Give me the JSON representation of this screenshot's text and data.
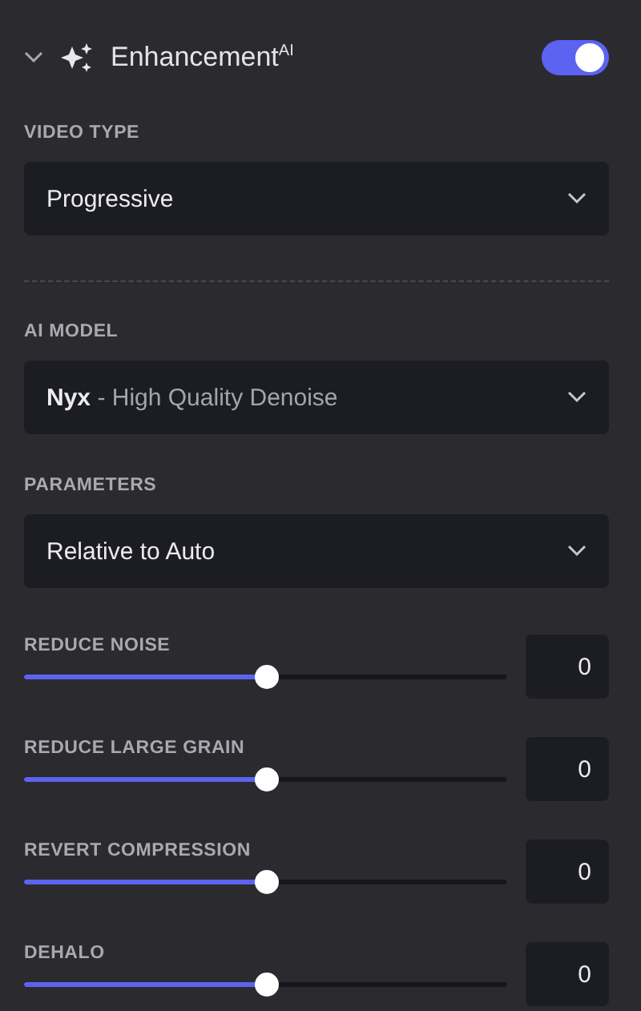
{
  "header": {
    "title": "Enhancement$^{AI}$",
    "expanded": true,
    "on": true
  },
  "video_type": {
    "label": "VIDEO TYPE",
    "value": "Progressive"
  },
  "ai_model": {
    "label": "AI MODEL",
    "name": "Nyx",
    "detail": "- High Quality Denoise"
  },
  "parameters": {
    "label": "PARAMETERS",
    "value": "Relative to Auto"
  },
  "sliders": [
    {
      "label": "REDUCE NOISE",
      "level": 0.5,
      "value": "0"
    },
    {
      "label": "REDUCE LARGE GRAIN",
      "level": 0.5,
      "value": "0"
    },
    {
      "label": "REVERT COMPRESSION",
      "level": 0.5,
      "value": "0"
    },
    {
      "label": "DEHALO",
      "level": 0.5,
      "value": "0"
    }
  ]
}
